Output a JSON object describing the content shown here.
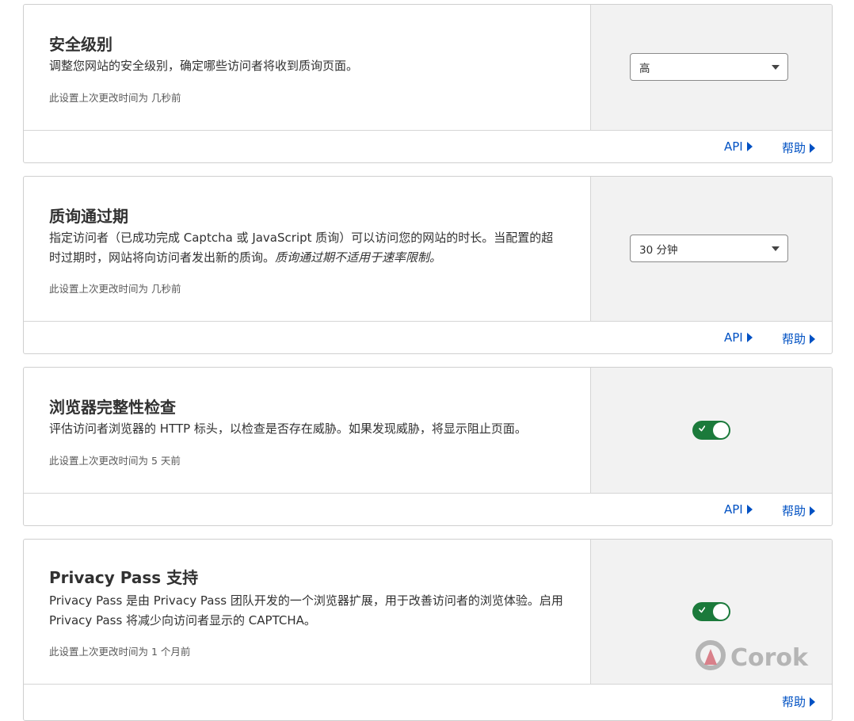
{
  "links": {
    "api": "API",
    "help": "帮助"
  },
  "cards": [
    {
      "title": "安全级别",
      "description": "调整您网站的安全级别，确定哪些访问者将收到质询页面。",
      "meta": "此设置上次更改时间为 几秒前",
      "control": {
        "type": "select",
        "value": "高"
      }
    },
    {
      "title": "质询通过期",
      "description": "指定访问者（已成功完成 Captcha 或 JavaScript 质询）可以访问您的网站的时长。当配置的超时过期时，网站将向访问者发出新的质询。",
      "description_italic": "质询通过期不适用于速率限制。",
      "meta": "此设置上次更改时间为 几秒前",
      "control": {
        "type": "select",
        "value": "30 分钟"
      }
    },
    {
      "title": "浏览器完整性检查",
      "description": "评估访问者浏览器的 HTTP 标头，以检查是否存在威胁。如果发现威胁，将显示阻止页面。",
      "meta": "此设置上次更改时间为 5 天前",
      "control": {
        "type": "toggle",
        "on": true
      }
    },
    {
      "title": "Privacy Pass 支持",
      "description": "Privacy Pass 是由 Privacy Pass 团队开发的一个浏览器扩展，用于改善访问者的浏览体验。启用 Privacy Pass 将减少向访问者显示的 CAPTCHA。",
      "meta": "此设置上次更改时间为 1 个月前",
      "control": {
        "type": "toggle",
        "on": true
      }
    }
  ],
  "watermark": "Corok",
  "colors": {
    "link": "#0051c3",
    "toggle_on": "#1b7a3b",
    "panel_bg": "#f2f2f2"
  }
}
